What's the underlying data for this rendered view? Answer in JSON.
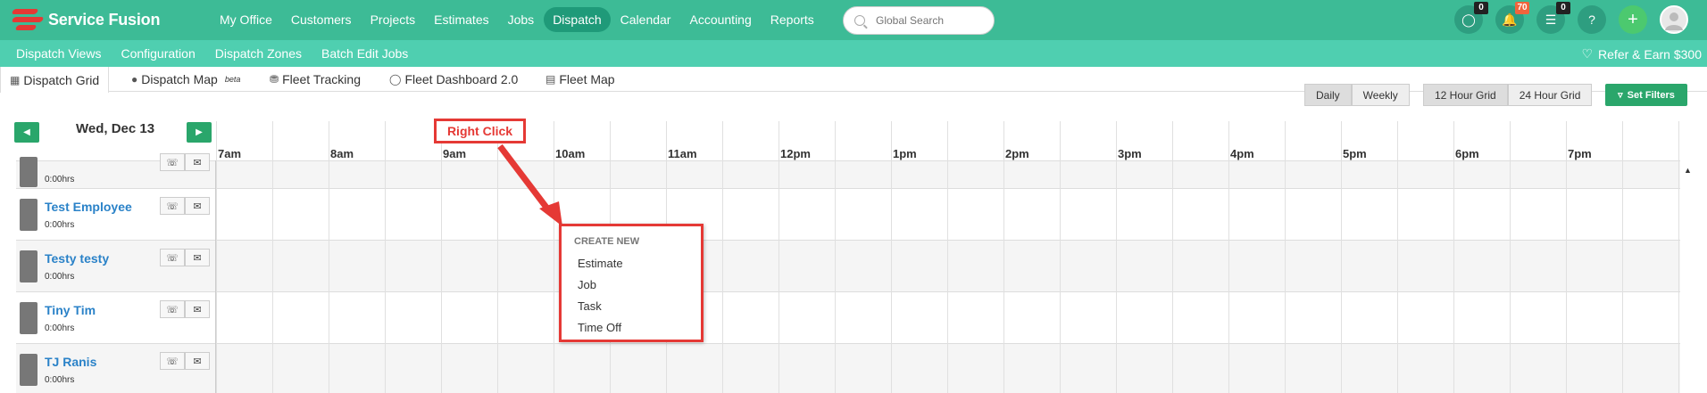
{
  "brand": {
    "name": "Service Fusion"
  },
  "nav": {
    "items": [
      "My Office",
      "Customers",
      "Projects",
      "Estimates",
      "Jobs",
      "Dispatch",
      "Calendar",
      "Accounting",
      "Reports"
    ],
    "active": "Dispatch"
  },
  "search": {
    "placeholder": "Global Search"
  },
  "topicons": {
    "chat_badge": "0",
    "bell_badge": "70",
    "list_badge": "0",
    "help": "?",
    "plus": "+"
  },
  "subnav": {
    "items": [
      "Dispatch Views",
      "Configuration",
      "Dispatch Zones",
      "Batch Edit Jobs"
    ],
    "refer": "Refer & Earn $300"
  },
  "tabs": [
    {
      "label": "Dispatch Grid",
      "icon": "grid-icon"
    },
    {
      "label": "Dispatch Map",
      "icon": "map-pin-icon",
      "sup": "beta"
    },
    {
      "label": "Fleet Tracking",
      "icon": "truck-icon"
    },
    {
      "label": "Fleet Dashboard 2.0",
      "icon": "gauge-icon"
    },
    {
      "label": "Fleet Map",
      "icon": "map-icon"
    }
  ],
  "views": {
    "daily": "Daily",
    "weekly": "Weekly",
    "selected": "Daily"
  },
  "gridmode": {
    "twelve": "12 Hour Grid",
    "twentyfour": "24 Hour Grid",
    "selected": "12 Hour Grid"
  },
  "filters": {
    "label": "Set Filters"
  },
  "date": {
    "label": "Wed, Dec 13"
  },
  "hours": [
    "7am",
    "8am",
    "9am",
    "10am",
    "11am",
    "12pm",
    "1pm",
    "2pm",
    "3pm",
    "4pm",
    "5pm",
    "6pm",
    "7pm"
  ],
  "employees": [
    {
      "name": "",
      "hrs": "0:00hrs"
    },
    {
      "name": "Test Employee",
      "hrs": "0:00hrs"
    },
    {
      "name": "Testy testy",
      "hrs": "0:00hrs"
    },
    {
      "name": "Tiny Tim",
      "hrs": "0:00hrs"
    },
    {
      "name": "TJ Ranis",
      "hrs": "0:00hrs"
    }
  ],
  "context_menu": {
    "header": "CREATE NEW",
    "items": [
      "Estimate",
      "Job",
      "Task",
      "Time Off"
    ]
  },
  "callout": {
    "label": "Right Click"
  },
  "colors": {
    "nav": "#3dbb96",
    "subnav": "#4fcfb0",
    "accent_red": "#e53935",
    "link": "#2a82c8",
    "green_btn": "#2aa66b"
  }
}
